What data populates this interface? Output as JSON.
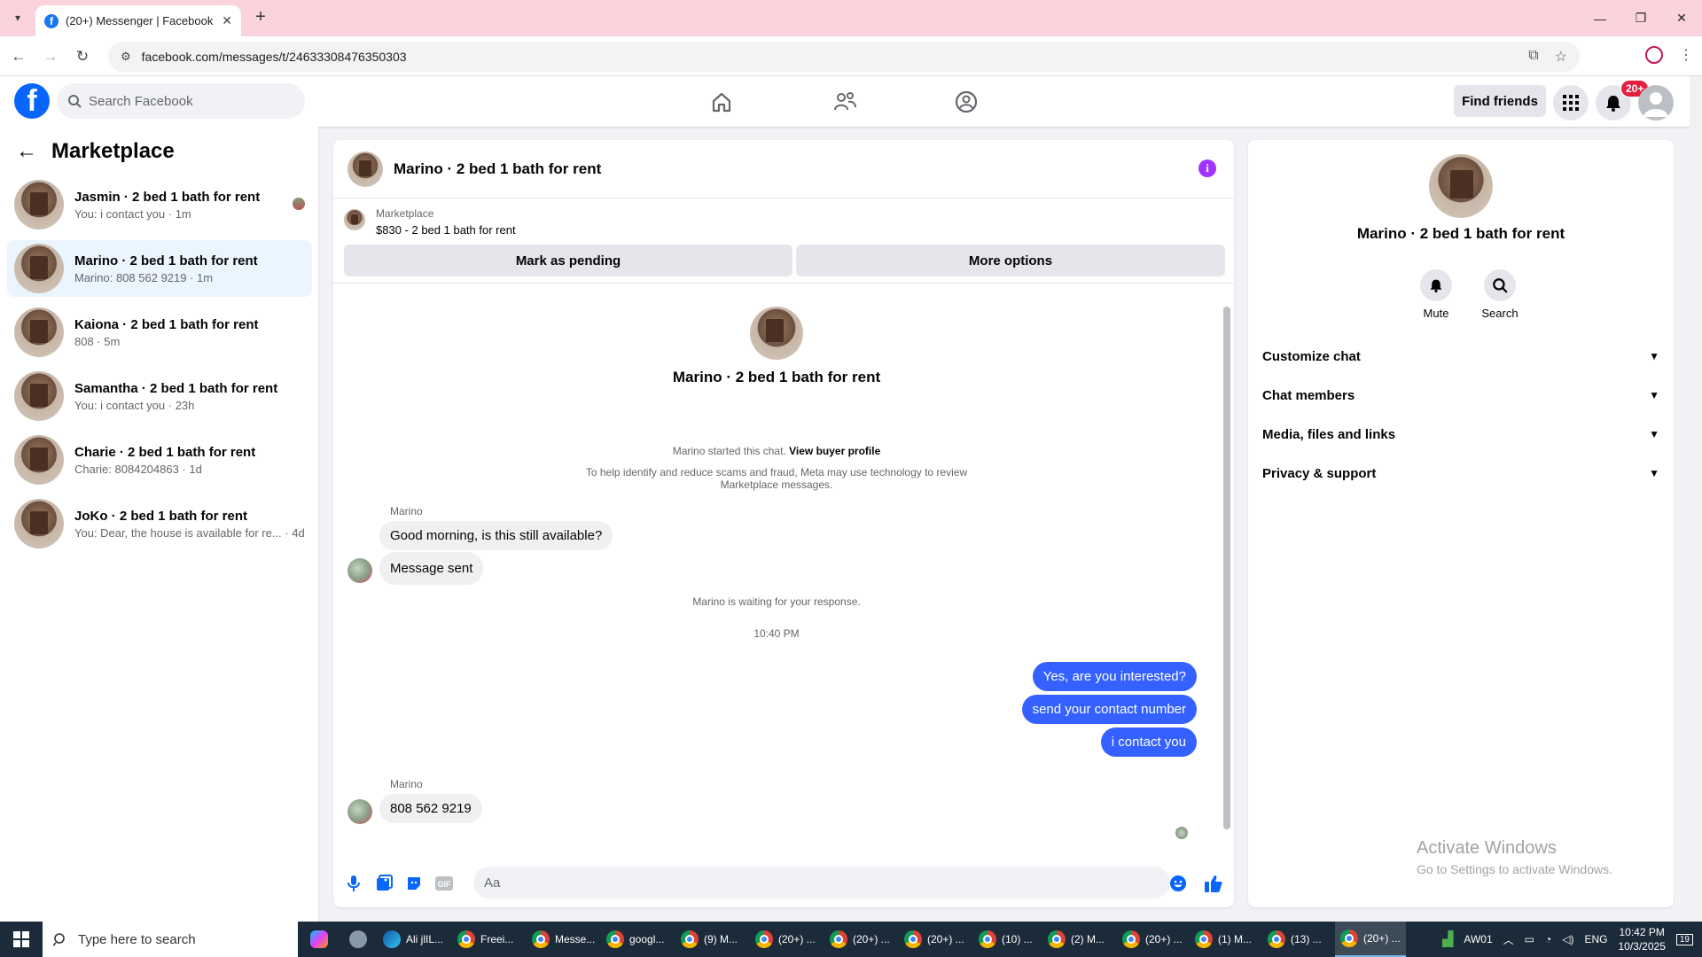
{
  "browser": {
    "tab_title": "(20+) Messenger | Facebook",
    "url": "facebook.com/messages/t/24633308476350303"
  },
  "fb": {
    "search_placeholder": "Search Facebook",
    "find_friends": "Find friends",
    "notif_count": "20+"
  },
  "left": {
    "title": "Marketplace",
    "conversations": [
      {
        "name": "Jasmin · 2 bed 1 bath for rent",
        "preview": "You: i contact you · 1m"
      },
      {
        "name": "Marino · 2 bed 1 bath for rent",
        "preview": "Marino: 808 562 9219 · 1m"
      },
      {
        "name": "Kaiona · 2 bed 1 bath for rent",
        "preview": "808 · 5m"
      },
      {
        "name": "Samantha · 2 bed 1 bath for rent",
        "preview": "You: i contact you · 23h"
      },
      {
        "name": "Charie · 2 bed 1 bath for rent",
        "preview": "Charie: 8084204863 · 1d"
      },
      {
        "name": "JoKo · 2 bed 1 bath for rent",
        "preview": "You: Dear, the house is available for re... · 4d"
      }
    ]
  },
  "chat": {
    "title": "Marino · 2 bed 1 bath for rent",
    "marketplace_label": "Marketplace",
    "listing": "$830 - 2 bed 1 bath for rent",
    "mark_pending": "Mark as pending",
    "more_options": "More options",
    "intro_name": "Marino · 2 bed 1 bath for rent",
    "started_text": "Marino started this chat.",
    "view_buyer": "View buyer profile",
    "scam_notice_1": "To help identify and reduce scams and fraud, Meta may use technology to review",
    "scam_notice_2": "Marketplace messages.",
    "sender": "Marino",
    "in_msg_1": "Good morning, is this still available?",
    "in_msg_2": "Message sent",
    "waiting": "Marino is waiting for your response.",
    "time": "10:40 PM",
    "out_msg_1": "Yes, are you interested?",
    "out_msg_2": "send your contact number",
    "out_msg_3": "i contact you",
    "in_msg_3": "808 562 9219",
    "composer_placeholder": "Aa"
  },
  "right": {
    "name": "Marino · 2 bed 1 bath for rent",
    "mute": "Mute",
    "search": "Search",
    "sections": [
      "Customize chat",
      "Chat members",
      "Media, files and links",
      "Privacy & support"
    ],
    "activate_1": "Activate Windows",
    "activate_2": "Go to Settings to activate Windows."
  },
  "taskbar": {
    "search_placeholder": "Type here to search",
    "apps": [
      "Ali jlIL...",
      "Freei...",
      "Messe...",
      "googl...",
      "(9) M...",
      "(20+) ...",
      "(20+) ...",
      "(20+) ...",
      "(10) ...",
      "(2) M...",
      "(20+) ...",
      "(1) M...",
      "(13) ...",
      "(20+) ..."
    ],
    "network": "AW01",
    "lang": "ENG",
    "time": "10:42 PM",
    "date": "10/3/2025",
    "notif": "19"
  }
}
